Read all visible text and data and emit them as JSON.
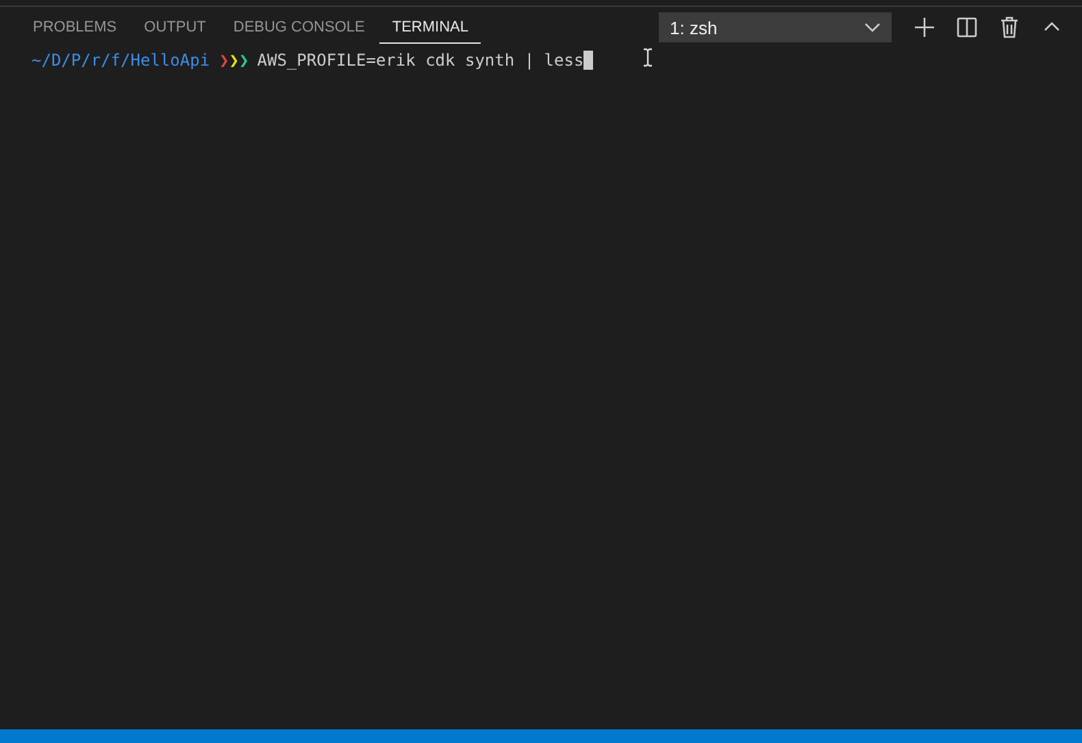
{
  "panel_tabs": [
    {
      "label": "PROBLEMS",
      "selected": false
    },
    {
      "label": "OUTPUT",
      "selected": false
    },
    {
      "label": "DEBUG CONSOLE",
      "selected": false
    },
    {
      "label": "TERMINAL",
      "selected": true
    }
  ],
  "terminal_select": {
    "value": "1: zsh"
  },
  "terminal": {
    "path": "~/D/P/r/f/HelloApi",
    "prompt_marks": [
      {
        "text": "❯",
        "color": "#e0443e"
      },
      {
        "text": "❯",
        "color": "#e5e510"
      },
      {
        "text": "❯",
        "color": "#23d18b"
      }
    ],
    "command": "AWS_PROFILE=erik cdk synth | less"
  }
}
